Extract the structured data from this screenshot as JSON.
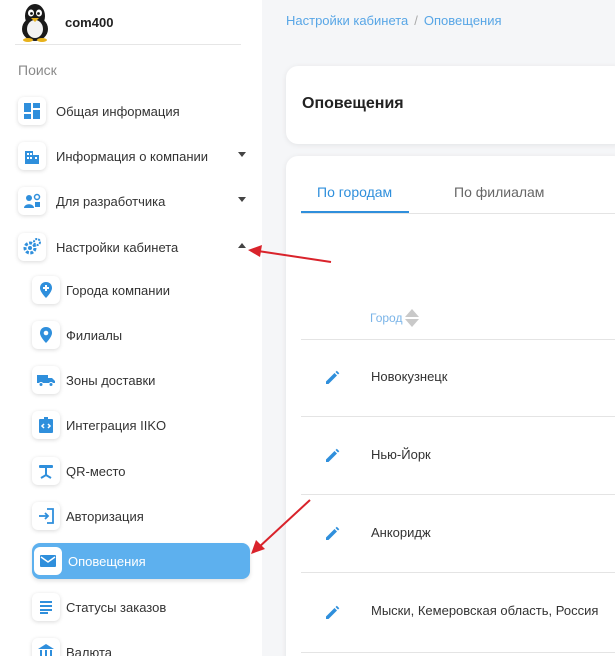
{
  "user": {
    "name": "com400",
    "avatar_icon": "penguin-icon"
  },
  "search": {
    "placeholder": "Поиск"
  },
  "sidebar": {
    "items": [
      {
        "label": "Общая информация",
        "icon": "dashboard-icon"
      },
      {
        "label": "Информация о компании",
        "icon": "building-icon",
        "expandable": true
      },
      {
        "label": "Для разработчика",
        "icon": "developer-icon",
        "expandable": true
      },
      {
        "label": "Настройки кабинета",
        "icon": "settings-icon",
        "expanded": true
      }
    ],
    "subitems": [
      {
        "label": "Города компании",
        "icon": "map-pin-plus-icon"
      },
      {
        "label": "Филиалы",
        "icon": "location-icon"
      },
      {
        "label": "Зоны доставки",
        "icon": "truck-icon"
      },
      {
        "label": "Интеграция IIKO",
        "icon": "integration-icon"
      },
      {
        "label": "QR-место",
        "icon": "table-icon"
      },
      {
        "label": "Авторизация",
        "icon": "login-icon"
      },
      {
        "label": "Оповещения",
        "icon": "mail-icon",
        "active": true
      },
      {
        "label": "Статусы заказов",
        "icon": "list-icon"
      },
      {
        "label": "Валюта",
        "icon": "bank-icon"
      }
    ]
  },
  "breadcrumb": {
    "parent": "Настройки кабинета",
    "separator": "/",
    "current": "Оповещения"
  },
  "page": {
    "title": "Оповещения"
  },
  "tabs": [
    {
      "label": "По городам",
      "active": true
    },
    {
      "label": "По филиалам",
      "active": false
    }
  ],
  "table": {
    "column": "Город",
    "rows": [
      "Новокузнецк",
      "Нью-Йорк",
      "Анкоридж",
      "Мыски, Кемеровская область, Россия"
    ]
  },
  "colors": {
    "accent": "#2f8fdc",
    "active_item": "#5db0ee",
    "annotation_arrow": "#d9232b"
  }
}
